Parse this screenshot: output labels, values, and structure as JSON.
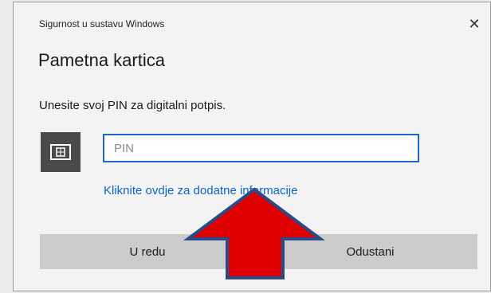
{
  "dialog": {
    "window_title": "Sigurnost u sustavu Windows",
    "close_glyph": "✕",
    "heading": "Pametna kartica",
    "prompt": "Unesite svoj PIN za digitalni potpis.",
    "card_icon": "smart-card-icon",
    "pin_input": {
      "value": "",
      "placeholder": "PIN"
    },
    "more_info_link": "Kliknite ovdje za dodatne informacije",
    "buttons": {
      "ok_label": "U redu",
      "cancel_label": "Odustani"
    }
  },
  "overlay": {
    "arrow_icon": "red-up-arrow-icon",
    "arrow_color": "#e00000",
    "arrow_outline_color": "#2a4a8a"
  },
  "colors": {
    "accent": "#1e66c8",
    "link": "#0b64c8",
    "button_bg": "#cccccc",
    "icon_tile_bg": "#4a4a4a"
  }
}
